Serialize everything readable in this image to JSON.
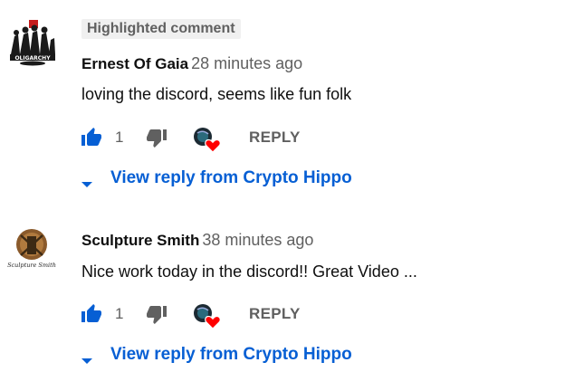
{
  "comments": [
    {
      "highlight_label": "Highlighted comment",
      "avatar_text": "OLIGARCHY",
      "author": "Ernest Of Gaia",
      "time": "28 minutes ago",
      "text": "loving the discord, seems like fun folk",
      "like_count": "1",
      "reply_label": "REPLY",
      "view_replies_label": "View reply from Crypto Hippo"
    },
    {
      "avatar_text": "Sculpture Smith",
      "author": "Sculpture Smith",
      "time": "38 minutes ago",
      "text": "Nice work today in the discord!! Great Video ...",
      "like_count": "1",
      "reply_label": "REPLY",
      "view_replies_label": "View reply from Crypto Hippo"
    }
  ],
  "colors": {
    "link_blue": "#065fd4",
    "like_active": "#065fd4",
    "muted_text": "#606060",
    "heart_red": "#ff0000"
  },
  "icons": {
    "like": "thumb-up-icon",
    "dislike": "thumb-down-icon",
    "creator_heart": "creator-heart-icon",
    "expand": "caret-down-icon"
  }
}
